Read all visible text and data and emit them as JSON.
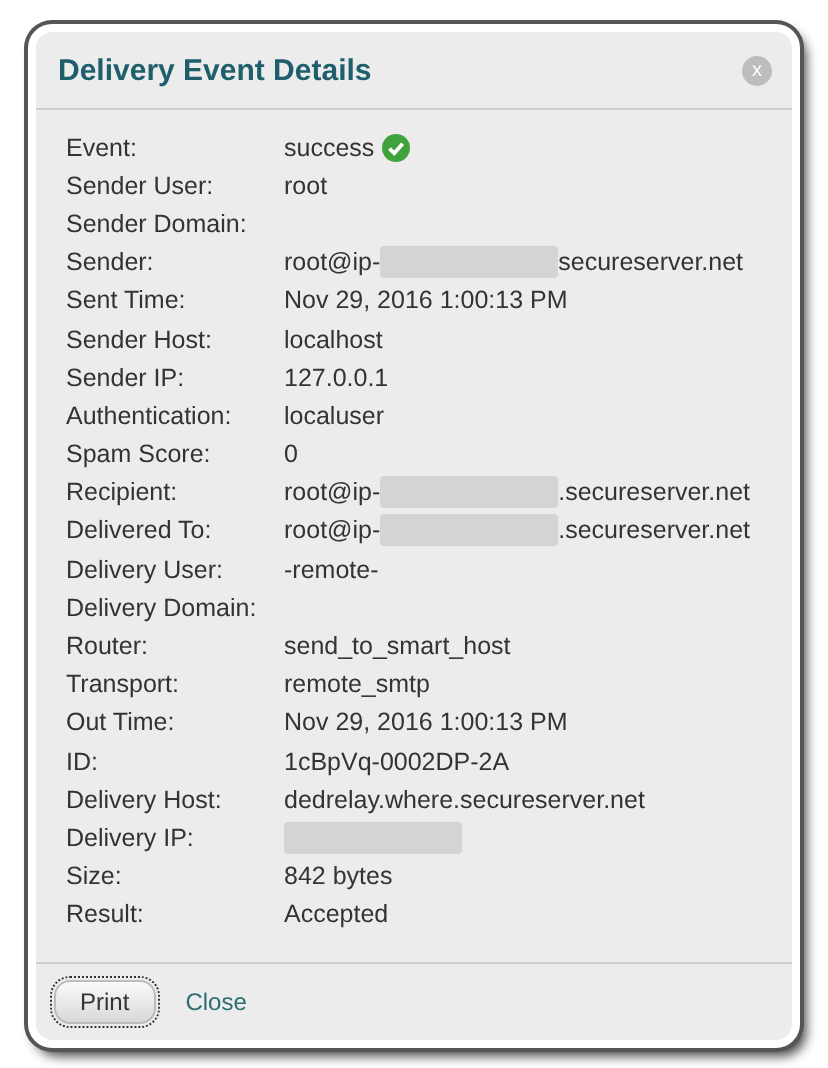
{
  "dialog": {
    "title": "Delivery Event Details",
    "close": "x"
  },
  "fields": [
    {
      "label": "Event:",
      "value": "success",
      "kind": "status"
    },
    {
      "label": "Sender User:",
      "value": "root",
      "kind": "text"
    },
    {
      "label": "Sender Domain:",
      "kind": "text"
    },
    {
      "label": "Sender:",
      "value": "root@ip-",
      "suffix": "secureserver.net",
      "kind": "redacted"
    },
    {
      "label": "Sent Time:",
      "value": "Nov 29, 2016 1:00:13 PM",
      "kind": "text"
    },
    {
      "label": "Sender Host:",
      "value": "localhost",
      "kind": "text"
    },
    {
      "label": "Sender IP:",
      "value": "127.0.0.1",
      "kind": "text"
    },
    {
      "label": "Authentication:",
      "value": "localuser",
      "kind": "text"
    },
    {
      "label": "Spam Score:",
      "value": "0",
      "kind": "text"
    },
    {
      "label": "Recipient:",
      "value": "root@ip-",
      "suffix": ".secureserver.net",
      "kind": "redacted"
    },
    {
      "label": "Delivered To:",
      "value": "root@ip-",
      "suffix": ".secureserver.net",
      "kind": "redacted"
    },
    {
      "label": "Delivery User:",
      "value": "-remote-",
      "kind": "text"
    },
    {
      "label": "Delivery Domain:",
      "kind": "text"
    },
    {
      "label": "Router:",
      "value": "send_to_smart_host",
      "kind": "text"
    },
    {
      "label": "Transport:",
      "value": "remote_smtp",
      "kind": "text"
    },
    {
      "label": "Out Time:",
      "value": "Nov 29, 2016 1:00:13 PM",
      "kind": "text"
    },
    {
      "label": "ID:",
      "value": "1cBpVq-0002DP-2A",
      "kind": "text"
    },
    {
      "label": "Delivery Host:",
      "value": "dedrelay.where.secureserver.net",
      "kind": "text"
    },
    {
      "label": "Delivery IP:",
      "kind": "redacted"
    },
    {
      "label": "Size:",
      "value": "842 bytes",
      "kind": "text"
    },
    {
      "label": "Result:",
      "value": "Accepted",
      "kind": "text"
    }
  ],
  "footer": {
    "print": "Print",
    "close": "Close"
  }
}
